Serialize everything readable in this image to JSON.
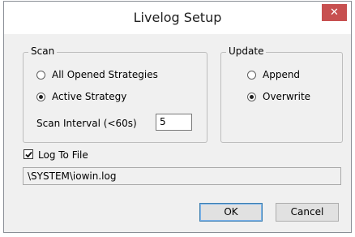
{
  "window": {
    "title": "Livelog Setup"
  },
  "scan": {
    "group_label": "Scan",
    "options": [
      {
        "label": "All Opened Strategies",
        "selected": false
      },
      {
        "label": "Active Strategy",
        "selected": true
      }
    ],
    "interval_label": "Scan Interval (<60s)",
    "interval_value": "5"
  },
  "update": {
    "group_label": "Update",
    "options": [
      {
        "label": "Append",
        "selected": false
      },
      {
        "label": "Overwrite",
        "selected": true
      }
    ]
  },
  "log": {
    "checkbox_label": "Log To File",
    "checked": true,
    "path": "\\SYSTEM\\iowin.log"
  },
  "buttons": {
    "ok": "OK",
    "cancel": "Cancel"
  },
  "icons": {
    "close": "close-icon"
  },
  "colors": {
    "close_button": "#c75050",
    "default_button_border": "#3c7fb1"
  }
}
